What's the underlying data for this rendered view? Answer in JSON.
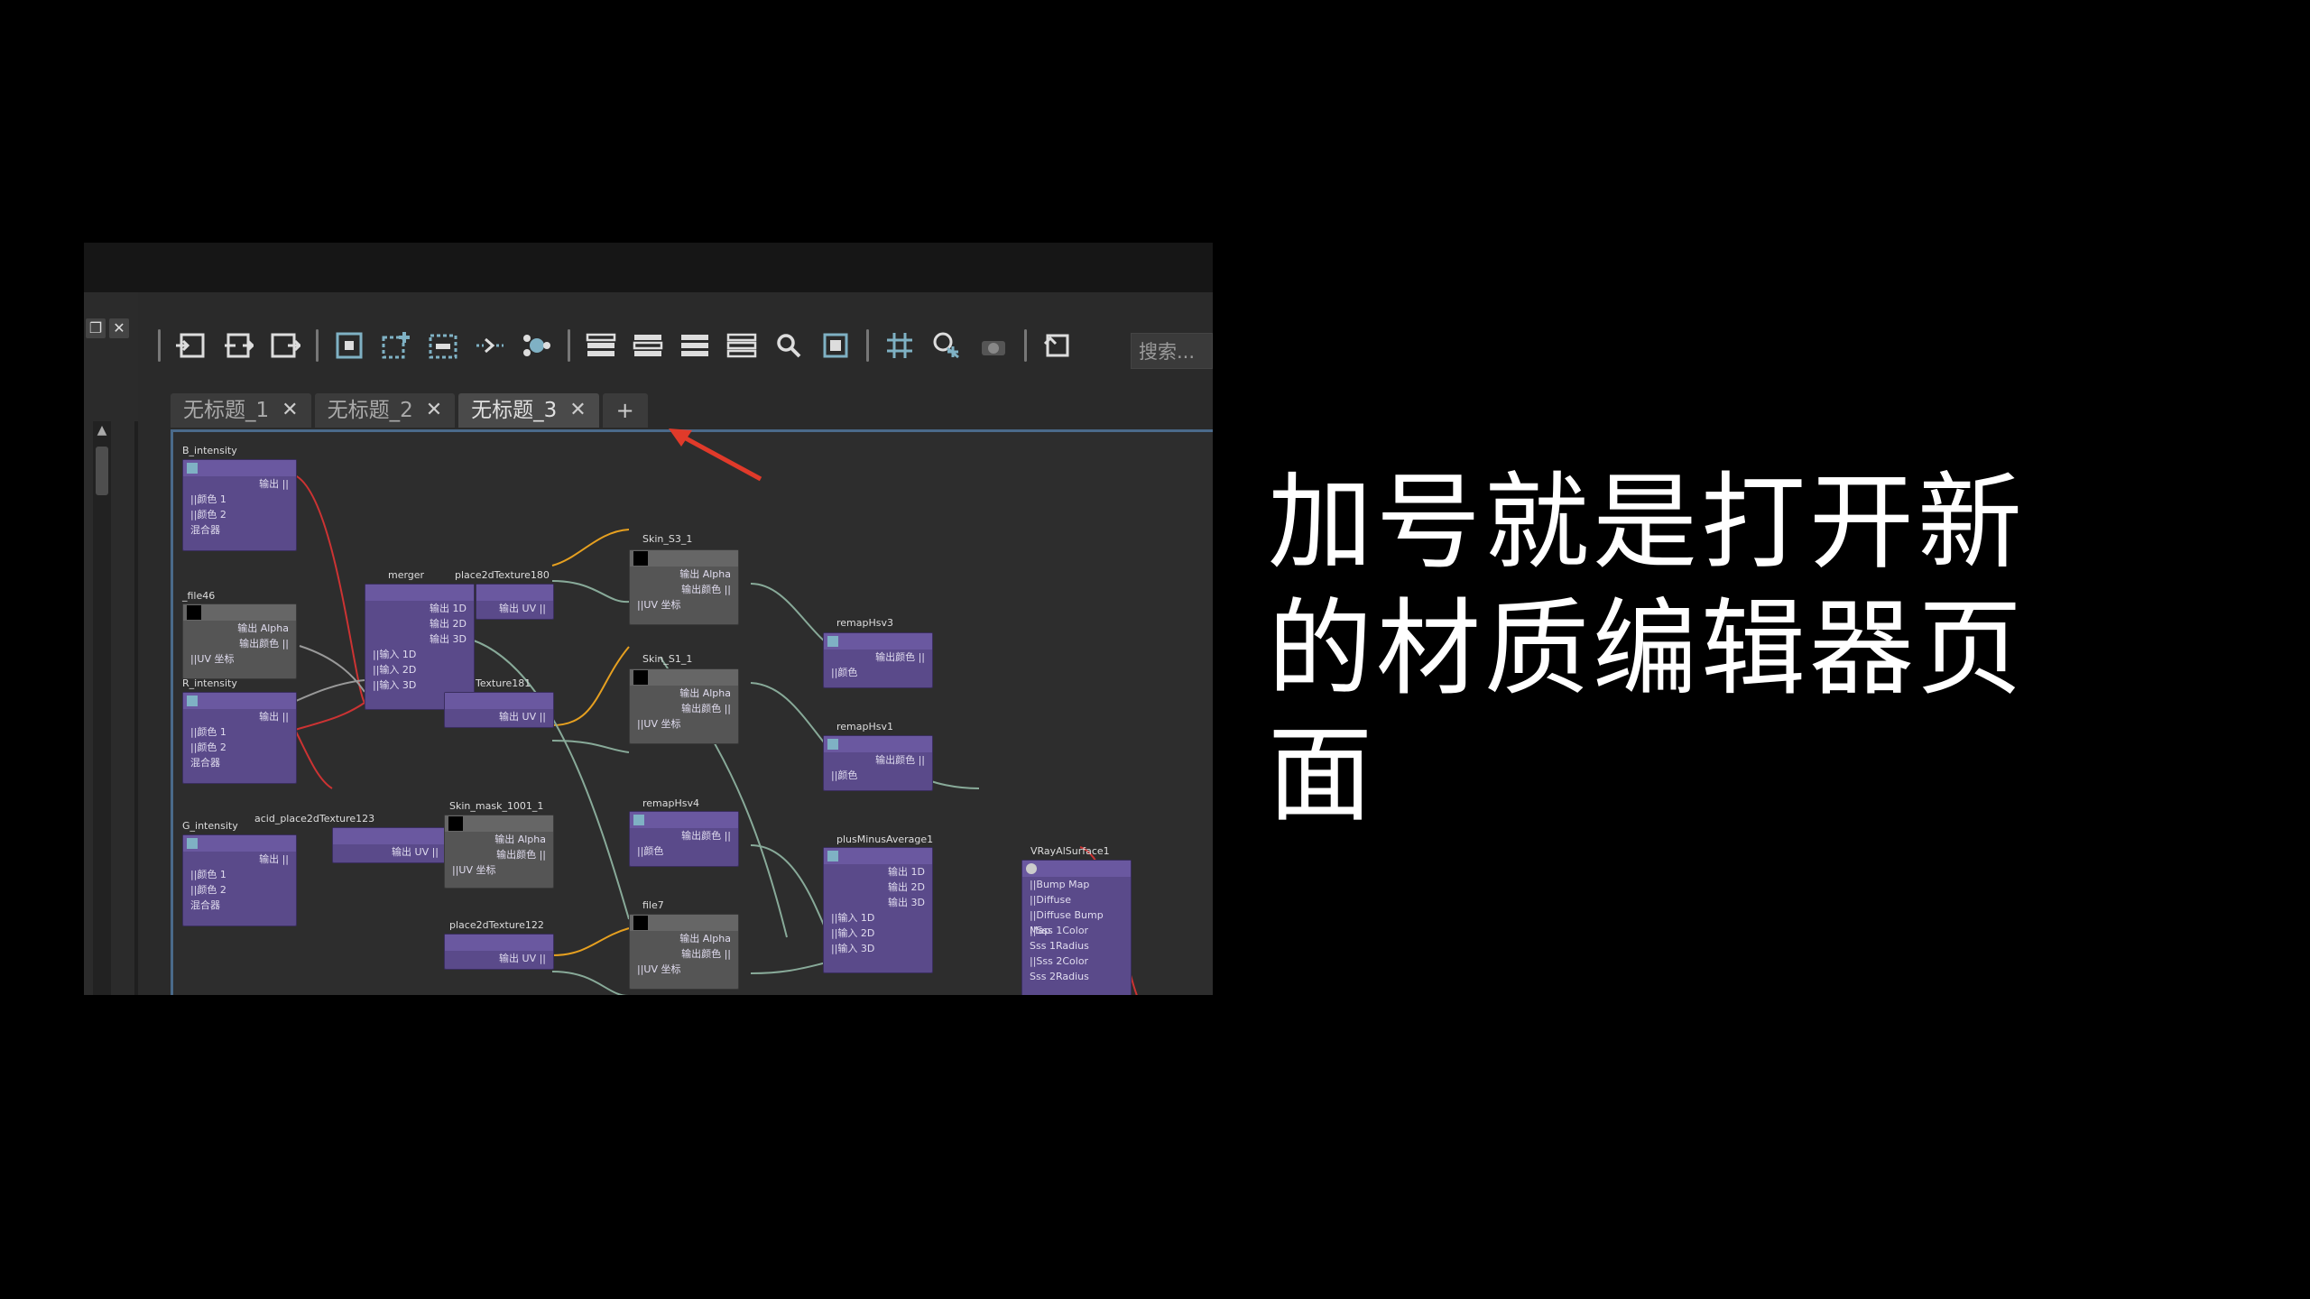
{
  "caption": {
    "text": "加号就是打开新的材质编辑器页面"
  },
  "window": {
    "restore_icon": "restore-icon",
    "close_icon": "close-icon"
  },
  "toolbar": {
    "search_placeholder": "搜索...",
    "icons": [
      "input-connections-icon",
      "output-connections-icon",
      "in-out-connections-icon",
      "frame-all-icon",
      "add-node-icon",
      "remove-node-icon",
      "graph-pin-icon",
      "graph-node-icon",
      "layout-list-icon",
      "layout-list-2-icon",
      "layout-list-3-icon",
      "layout-list-4-icon",
      "magnifier-icon",
      "snap-icon",
      "grid-icon",
      "pin-node-icon",
      "camera-icon",
      "refresh-icon"
    ]
  },
  "tabs": [
    {
      "label": "无标题_1",
      "active": false
    },
    {
      "label": "无标题_2",
      "active": false
    },
    {
      "label": "无标题_3",
      "active": true
    }
  ],
  "add_tab_label": "+",
  "nodes": {
    "b_intensity": {
      "title": "B_intensity",
      "rows": [
        "输出 ||",
        "||颜色 1",
        "||颜色 2",
        "混合器"
      ]
    },
    "file46": {
      "title": "_file46",
      "rows": [
        "输出 Alpha",
        "输出颜色 ||",
        "||UV 坐标"
      ]
    },
    "r_intensity": {
      "title": "R_intensity",
      "rows": [
        "输出 ||",
        "||颜色 1",
        "||颜色 2",
        "混合器"
      ]
    },
    "g_intensity": {
      "title": "G_intensity",
      "rows": [
        "输出 ||",
        "||颜色 1",
        "||颜色 2",
        "混合器"
      ]
    },
    "merger": {
      "title": "merger",
      "rows": [
        "输出 1D",
        "输出 2D",
        "输出 3D",
        "||输入 1D",
        "||输入 2D",
        "||输入 3D"
      ]
    },
    "place180": {
      "title": "place2dTexture180",
      "rows": [
        "输出 UV ||"
      ]
    },
    "place181": {
      "title": "Texture181",
      "rows": [
        "输出 UV ||"
      ]
    },
    "place123": {
      "title": "acid_place2dTexture123",
      "rows": [
        "输出 UV ||"
      ]
    },
    "skin_s3": {
      "title": "Skin_S3_1",
      "rows": [
        "输出 Alpha",
        "输出颜色 ||",
        "||UV 坐标"
      ]
    },
    "skin_s1": {
      "title": "Skin_S1_1",
      "rows": [
        "输出 Alpha",
        "输出颜色 ||",
        "||UV 坐标"
      ]
    },
    "skin_mask": {
      "title": "Skin_mask_1001_1",
      "rows": [
        "输出 Alpha",
        "输出颜色 ||",
        "||UV 坐标"
      ]
    },
    "place122": {
      "title": "place2dTexture122",
      "rows": [
        "输出 UV ||"
      ]
    },
    "file7": {
      "title": "file7",
      "rows": [
        "输出 Alpha",
        "输出颜色 ||",
        "||UV 坐标"
      ]
    },
    "remaphsv3": {
      "title": "remapHsv3",
      "rows": [
        "输出颜色 ||",
        "||颜色"
      ]
    },
    "remaphsv1": {
      "title": "remapHsv1",
      "rows": [
        "输出颜色 ||",
        "||颜色"
      ]
    },
    "remaphsv4": {
      "title": "remapHsv4",
      "rows": [
        "输出颜色 ||",
        "||颜色"
      ]
    },
    "plusminus": {
      "title": "plusMinusAverage1",
      "rows": [
        "输出 1D",
        "输出 2D",
        "输出 3D",
        "||输入 1D",
        "||输入 2D",
        "||输入 3D"
      ]
    },
    "vray": {
      "title": "VRayAlSurface1",
      "rows": [
        "||Bump Map",
        "||Diffuse",
        "||Diffuse Bump Map",
        "||Sss 1Color",
        "Sss 1Radius",
        "||Sss 2Color",
        "Sss 2Radius"
      ]
    }
  }
}
